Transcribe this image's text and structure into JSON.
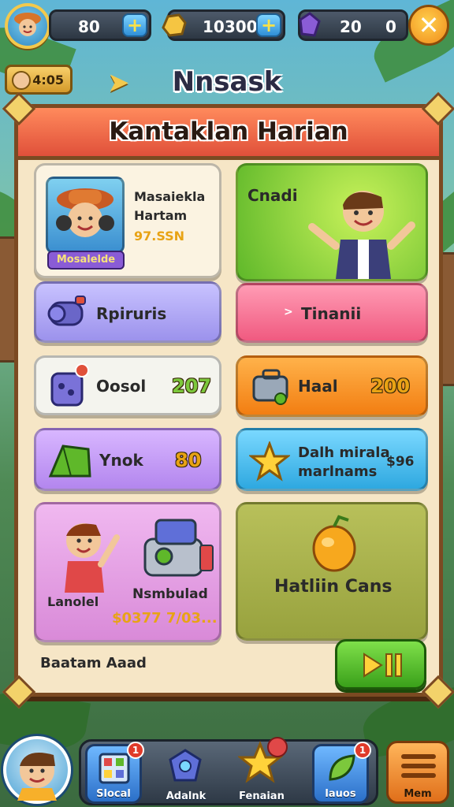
{
  "top_bar": {
    "coins": "80",
    "gold": "10300",
    "gems": "20",
    "gems_extra": "0",
    "badge_time": "4:05"
  },
  "header": {
    "title": "Nnsask"
  },
  "panel": {
    "title": "Kantaklan Harian",
    "cards": {
      "profile": {
        "name_line1": "Masaiekla",
        "name_line2": "Hartam",
        "price": "97.SSN",
        "tag": "Mosalelde"
      },
      "green_top": {
        "label": "Cnadi"
      },
      "purple1": {
        "label": "Rpiruris"
      },
      "pink": {
        "label": "Tinanii",
        "arrow": ">"
      },
      "white": {
        "label": "Oosol",
        "value": "207"
      },
      "orange": {
        "label": "Haal",
        "value": "200"
      },
      "purple2": {
        "label": "Ynok",
        "value": "80"
      },
      "cyan": {
        "label_line1": "Dalh mirala",
        "label_line2": "marlnams",
        "value": "$96"
      },
      "bottom_left": {
        "label1": "Lanolel",
        "label2": "Nsmbulad",
        "price": "$0377 7/03..."
      },
      "olive": {
        "label": "Hatliin Cans"
      }
    },
    "footer_label": "Baatam Aaad"
  },
  "nav": {
    "items": [
      {
        "label": "Slocal",
        "badge": "1"
      },
      {
        "label": "Adalnk",
        "badge": ""
      },
      {
        "label": "Fenaian",
        "badge": ""
      },
      {
        "label": "lauos",
        "badge": "1"
      }
    ],
    "menu_label": "Mem"
  },
  "colors": {
    "panel_bg": "#f6e6c6",
    "header_red": "#e0503a",
    "card_green": "#7cc83c",
    "card_purple": "#b9b2f2",
    "card_pink": "#ff7a9c",
    "card_orange": "#f7931e",
    "card_cyan": "#32b6e6",
    "card_olive": "#a8b44a"
  }
}
